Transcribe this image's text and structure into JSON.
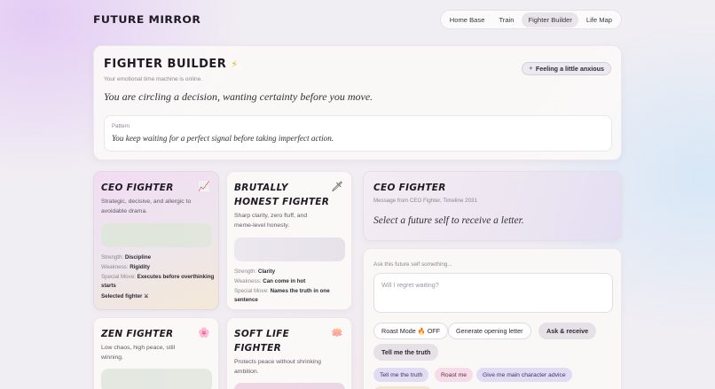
{
  "brand": "FUTURE MIRROR",
  "nav": [
    {
      "label": "Home Base",
      "active": false
    },
    {
      "label": "Train",
      "active": false
    },
    {
      "label": "Fighter Builder",
      "active": true
    },
    {
      "label": "Life Map",
      "active": false
    }
  ],
  "hero": {
    "title": "FIGHTER BUILDER",
    "subtitle": "Your emotional time machine is online.",
    "statement": "You are circling a decision, wanting certainty before you move.",
    "mood": "Feeling a little anxious",
    "pattern_label": "Pattern",
    "pattern_text": "You keep waiting for a perfect signal before taking imperfect action."
  },
  "fighters": [
    {
      "name": "CEO FIGHTER",
      "icon": "chart-icon",
      "desc": "Strategic, decisive, and allergic to avoidable drama.",
      "strength": "Discipline",
      "weakness": "Rigidity",
      "special": "Executes before overthinking starts",
      "selected_label": "Selected fighter ⚔"
    },
    {
      "name": "BRUTALLY HONEST FIGHTER",
      "icon": "dagger-icon",
      "desc": "Sharp clarity, zero fluff, and meme-level honesty.",
      "strength": "Clarity",
      "weakness": "Can come in hot",
      "special": "Names the truth in one sentence"
    },
    {
      "name": "ZEN FIGHTER",
      "icon": "blossom-icon",
      "desc": "Low chaos, high peace, still winning."
    },
    {
      "name": "SOFT LIFE FIGHTER",
      "icon": "lotus-icon",
      "desc": "Protects peace without shrinking ambition."
    }
  ],
  "stat_labels": {
    "strength": "Strength:",
    "weakness": "Weakness:",
    "special": "Special Move:"
  },
  "letter": {
    "title": "CEO FIGHTER",
    "meta": "Message from CEO Fighter, Timeline 2031",
    "body": "Select a future self to receive a letter."
  },
  "ask": {
    "label": "Ask this future self something...",
    "placeholder": "Will I regret waiting?",
    "roast_mode": "Roast Mode 🔥 OFF",
    "generate": "Generate opening letter",
    "ask_receive": "Ask & receive",
    "tell_truth": "Tell me the truth",
    "chips": [
      "Tell me the truth",
      "Roast me",
      "Give me main character advice"
    ]
  },
  "colors": {
    "chip_lavender": "#e1dcf3",
    "chip_pink": "#f6dbe8",
    "bolt": "#e9b422"
  }
}
